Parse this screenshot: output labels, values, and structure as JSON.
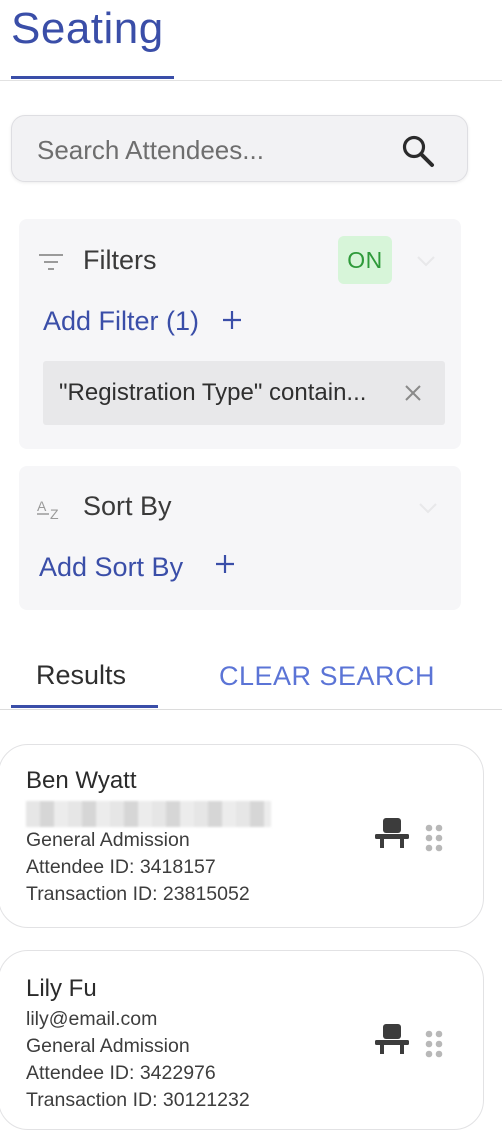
{
  "header": {
    "title": "Seating"
  },
  "search": {
    "placeholder": "Search Attendees..."
  },
  "filters": {
    "heading": "Filters",
    "status": "ON",
    "add_label": "Add Filter (1)",
    "chips": [
      {
        "text": "\"Registration Type\" contain..."
      }
    ]
  },
  "sort": {
    "heading": "Sort By",
    "add_label": "Add Sort By"
  },
  "tabs": {
    "results_label": "Results",
    "clear_label": "CLEAR SEARCH"
  },
  "results": [
    {
      "name": "Ben Wyatt",
      "email": "",
      "registration": "General Admission",
      "attendee_id": "Attendee ID: 3418157",
      "transaction_id": "Transaction ID: 23815052"
    },
    {
      "name": "Lily Fu",
      "email": "lily@email.com",
      "registration": "General Admission",
      "attendee_id": "Attendee ID: 3422976",
      "transaction_id": "Transaction ID: 30121232"
    }
  ],
  "colors": {
    "accent": "#3a4ea8",
    "link": "#5b74d6",
    "on_badge_bg": "#d7f5d9",
    "on_badge_text": "#2e9a3a"
  },
  "icons": {
    "search": "search-icon",
    "filter": "filter-lines-icon",
    "sort": "sort-az-icon",
    "add": "plus-icon",
    "remove": "close-icon",
    "expand": "chevron-down-icon",
    "seat": "seat-icon",
    "drag": "drag-handle-icon"
  }
}
